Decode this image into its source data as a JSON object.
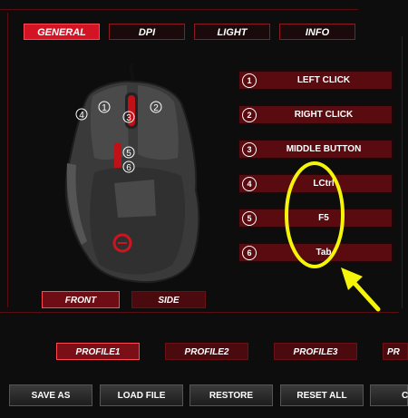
{
  "tabs": [
    {
      "label": "GENERAL",
      "active": true
    },
    {
      "label": "DPI",
      "active": false
    },
    {
      "label": "LIGHT",
      "active": false
    },
    {
      "label": "INFO",
      "active": false
    }
  ],
  "mouse": {
    "callouts": [
      "1",
      "2",
      "3",
      "4",
      "5",
      "6"
    ]
  },
  "buttons": [
    {
      "num": "1",
      "label": "LEFT CLICK"
    },
    {
      "num": "2",
      "label": "RIGHT CLICK"
    },
    {
      "num": "3",
      "label": "MIDDLE BUTTON"
    },
    {
      "num": "4",
      "label": "LCtrl"
    },
    {
      "num": "5",
      "label": "F5"
    },
    {
      "num": "6",
      "label": "Tab"
    }
  ],
  "views": {
    "front": "FRONT",
    "side": "SIDE"
  },
  "profiles": [
    {
      "label": "PROFILE1",
      "active": true
    },
    {
      "label": "PROFILE2",
      "active": false
    },
    {
      "label": "PROFILE3",
      "active": false
    },
    {
      "label": "PR",
      "active": false
    }
  ],
  "actions": [
    "SAVE AS",
    "LOAD FILE",
    "RESTORE",
    "RESET ALL",
    "C"
  ],
  "colors": {
    "accent": "#d31424",
    "row": "#5a0b10",
    "annotation": "#f5f50a"
  }
}
